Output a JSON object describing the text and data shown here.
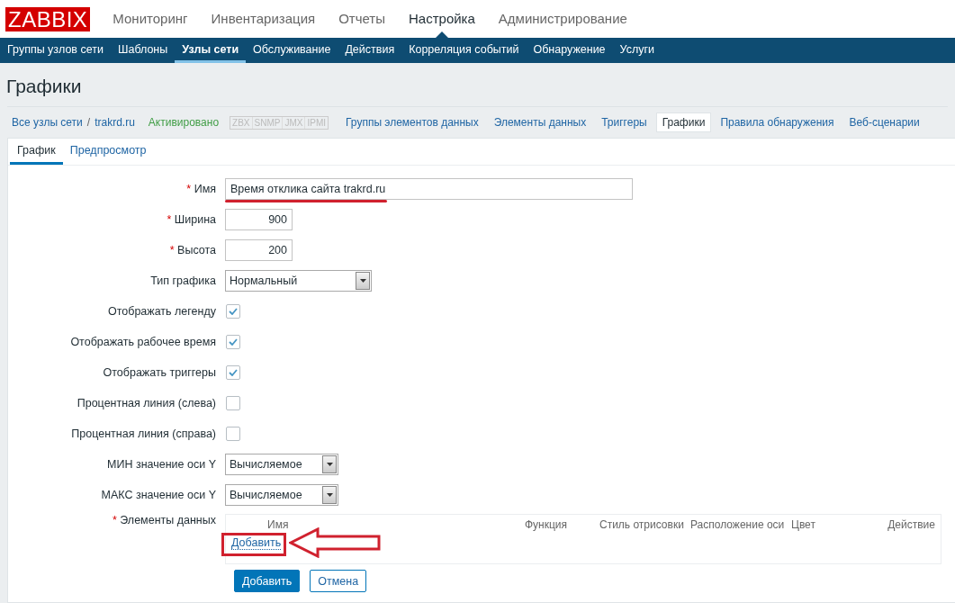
{
  "logo": "ZABBIX",
  "top_menu": [
    {
      "label": "Мониторинг",
      "selected": false
    },
    {
      "label": "Инвентаризация",
      "selected": false
    },
    {
      "label": "Отчеты",
      "selected": false
    },
    {
      "label": "Настройка",
      "selected": true
    },
    {
      "label": "Администрирование",
      "selected": false
    }
  ],
  "sub_menu": [
    {
      "label": "Группы узлов сети",
      "selected": false
    },
    {
      "label": "Шаблоны",
      "selected": false
    },
    {
      "label": "Узлы сети",
      "selected": true
    },
    {
      "label": "Обслуживание",
      "selected": false
    },
    {
      "label": "Действия",
      "selected": false
    },
    {
      "label": "Корреляция событий",
      "selected": false
    },
    {
      "label": "Обнаружение",
      "selected": false
    },
    {
      "label": "Услуги",
      "selected": false
    }
  ],
  "page_title": "Графики",
  "host_nav": {
    "breadcrumbs": [
      "Все узлы сети",
      "trakrd.ru"
    ],
    "separator": "/",
    "status": "Активировано",
    "availability": [
      "ZBX",
      "SNMP",
      "JMX",
      "IPMI"
    ],
    "links": [
      {
        "label": "Группы элементов данных",
        "selected": false
      },
      {
        "label": "Элементы данных",
        "selected": false
      },
      {
        "label": "Триггеры",
        "selected": false
      },
      {
        "label": "Графики",
        "selected": true
      },
      {
        "label": "Правила обнаружения",
        "selected": false
      },
      {
        "label": "Веб-сценарии",
        "selected": false
      }
    ]
  },
  "form_tabs": [
    {
      "label": "График",
      "selected": true
    },
    {
      "label": "Предпросмотр",
      "selected": false
    }
  ],
  "required_mark": "*",
  "fields": [
    {
      "kind": "text",
      "label": "Имя",
      "required": true,
      "value": "Время отклика сайта trakrd.ru"
    },
    {
      "kind": "text",
      "label": "Ширина",
      "required": true,
      "value": "900"
    },
    {
      "kind": "text",
      "label": "Высота",
      "required": true,
      "value": "200"
    },
    {
      "kind": "select",
      "label": "Тип графика",
      "required": false,
      "value": "Нормальный"
    },
    {
      "kind": "checkbox",
      "label": "Отображать легенду",
      "required": false,
      "checked": true
    },
    {
      "kind": "checkbox",
      "label": "Отображать рабочее время",
      "required": false,
      "checked": true
    },
    {
      "kind": "checkbox",
      "label": "Отображать триггеры",
      "required": false,
      "checked": true
    },
    {
      "kind": "checkbox",
      "label": "Процентная линия (слева)",
      "required": false,
      "checked": false
    },
    {
      "kind": "checkbox",
      "label": "Процентная линия (справа)",
      "required": false,
      "checked": false
    },
    {
      "kind": "select",
      "label": "МИН значение оси Y",
      "required": false,
      "value": "Вычисляемое"
    },
    {
      "kind": "select",
      "label": "МАКС значение оси Y",
      "required": false,
      "value": "Вычисляемое"
    }
  ],
  "items_table": {
    "label": "Элементы данных",
    "required": true,
    "columns": [
      "Имя",
      "Функция",
      "Стиль отрисовки",
      "Расположение оси",
      "Цвет",
      "Действие"
    ],
    "add_link": "Добавить"
  },
  "buttons": [
    {
      "label": "Добавить",
      "kind": "primary"
    },
    {
      "label": "Отмена",
      "kind": "secondary"
    }
  ]
}
